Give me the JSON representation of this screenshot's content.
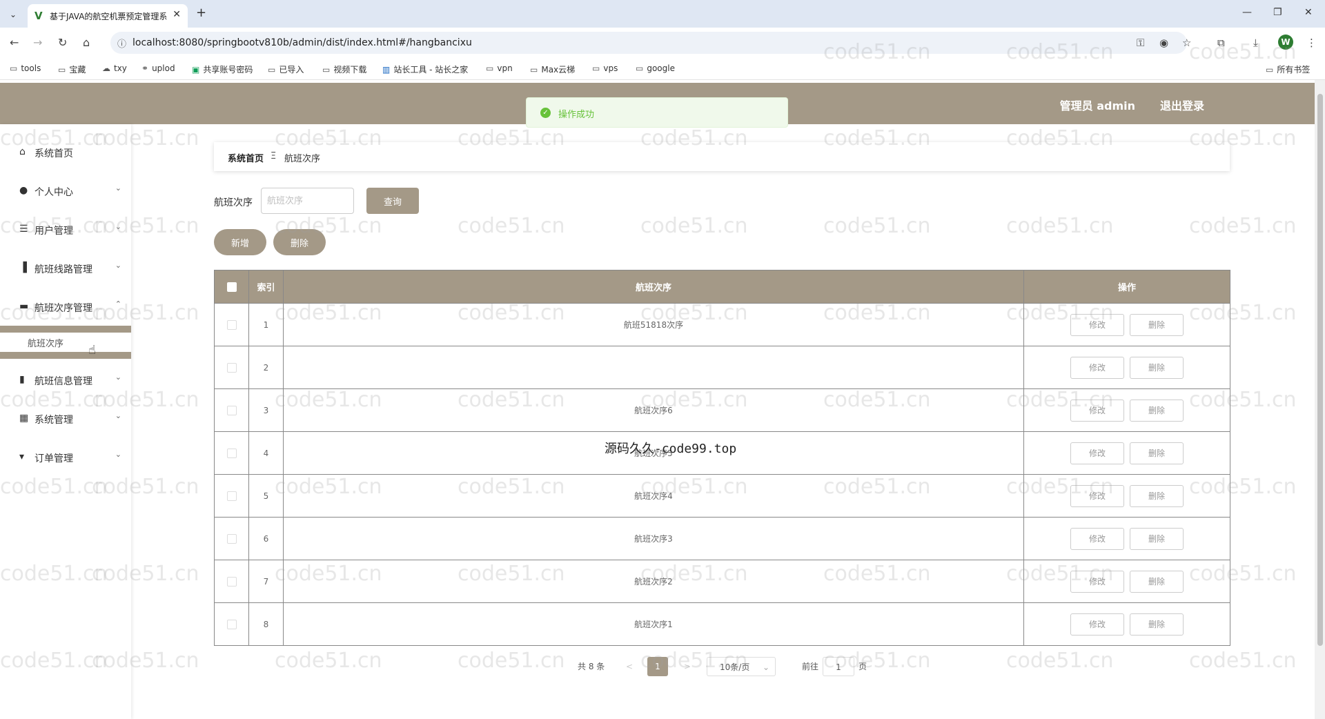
{
  "browser": {
    "tab_title": "基于JAVA的航空机票预定管理系统",
    "url": "localhost:8080/springbootv810b/admin/dist/index.html#/hangbancixu",
    "profile_initial": "W",
    "bookmarks": [
      "tools",
      "宝藏",
      "txy",
      "uplod",
      "共享账号密码",
      "已导入",
      "视频下载",
      "站长工具 - 站长之家",
      "vpn",
      "Max云梯",
      "vps",
      "google"
    ],
    "all_bookmarks": "所有书签"
  },
  "header": {
    "user": "管理员 admin",
    "logout": "退出登录"
  },
  "toast": {
    "text": "操作成功"
  },
  "sidebar": {
    "items": [
      {
        "label": "系统首页",
        "icon": "home-icon"
      },
      {
        "label": "个人中心",
        "icon": "user-icon"
      },
      {
        "label": "用户管理",
        "icon": "list-icon"
      },
      {
        "label": "航班线路管理",
        "icon": "chart-icon"
      },
      {
        "label": "航班次序管理",
        "icon": "briefcase-icon"
      },
      {
        "label": "航班信息管理",
        "icon": "bar-chart-icon"
      },
      {
        "label": "系统管理",
        "icon": "grid-icon"
      },
      {
        "label": "订单管理",
        "icon": "flag-icon"
      }
    ],
    "sub_item": "航班次序"
  },
  "breadcrumb": {
    "home": "系统首页",
    "separator": "Ξ",
    "current": "航班次序"
  },
  "search": {
    "label": "航班次序",
    "placeholder": "航班次序",
    "value": "",
    "query": "查询"
  },
  "actions": {
    "add": "新增",
    "delete": "删除"
  },
  "table": {
    "headers": {
      "index": "索引",
      "name": "航班次序",
      "ops": "操作"
    },
    "rows": [
      {
        "index": "1",
        "name": "航班51818次序"
      },
      {
        "index": "2",
        "name": ""
      },
      {
        "index": "3",
        "name": "航班次序6"
      },
      {
        "index": "4",
        "name": "航班次序5"
      },
      {
        "index": "5",
        "name": "航班次序4"
      },
      {
        "index": "6",
        "name": "航班次序3"
      },
      {
        "index": "7",
        "name": "航班次序2"
      },
      {
        "index": "8",
        "name": "航班次序1"
      }
    ],
    "edit": "修改",
    "remove": "删除"
  },
  "pager": {
    "total": "共 8 条",
    "prev": "<",
    "page": "1",
    "next": ">",
    "size": "10条/页",
    "goto": "前往",
    "goto_value": "1",
    "page_unit": "页"
  },
  "overlay_text": "源码久久-code99.top",
  "watermark": "code51.cn",
  "colors": {
    "theme": "#a49987",
    "success": "#67c23a"
  }
}
